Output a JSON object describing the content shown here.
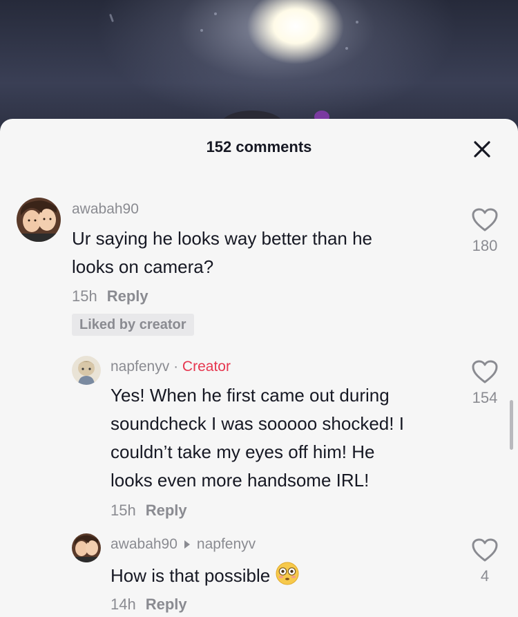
{
  "sheet": {
    "title": "152 comments"
  },
  "comments": [
    {
      "username": "awabah90",
      "text_line1": "Ur saying he looks way better than he",
      "text_line2": "looks on camera?",
      "time": "15h",
      "reply_label": "Reply",
      "badge": "Liked by creator",
      "likes": "180"
    }
  ],
  "replies": [
    {
      "username": "napfenyv",
      "separator": "·",
      "tag": "Creator",
      "text_lines": [
        "Yes! When he first came out during",
        "soundcheck I was sooooo shocked! I",
        "couldn’t take my eyes off him! He",
        "looks even more handsome IRL!"
      ],
      "time": "15h",
      "reply_label": "Reply",
      "likes": "154"
    },
    {
      "username": "awabah90",
      "reply_to": "napfenyv",
      "text": "How is that possible",
      "emoji": "flushed-face-emoji",
      "time": "14h",
      "reply_label": "Reply",
      "likes": "4"
    }
  ],
  "icons": {
    "close": "close-icon",
    "like": "heart-outline-icon"
  },
  "colors": {
    "creator": "#e6364f",
    "muted": "#8a8b91",
    "text": "#161823",
    "sheet_bg": "#f6f6f6"
  }
}
